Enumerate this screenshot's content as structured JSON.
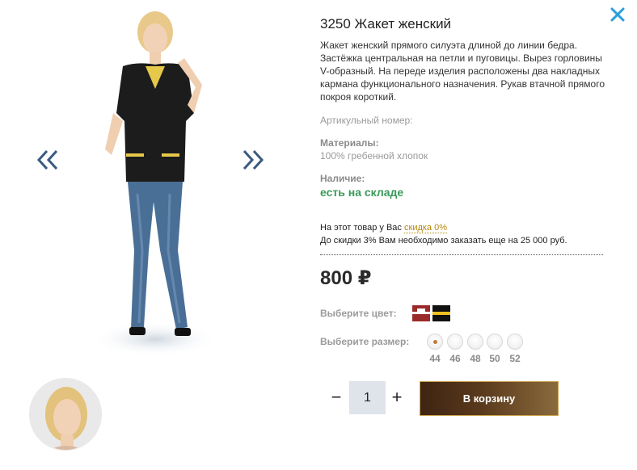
{
  "product": {
    "title": "3250 Жакет женский",
    "description": "Жакет женский прямого силуэта длиной до линии бедра. Застёжка центральная на петли и пуговицы. Вырез горловины V-образный. На переде изделия расположены два накладных кармана функционального назначения. Рукав втачной прямого покроя короткий.",
    "article_label": "Артикульный номер:",
    "materials_label": "Материалы:",
    "materials_value": "100% гребенной хлопок",
    "availability_label": "Наличие:",
    "availability_value": "есть на складе",
    "discount_text": "На этот товар у Вас",
    "discount_link": "скидка 0%",
    "discount_note": "До скидки 3% Вам необходимо заказать еще на 25 000 руб.",
    "price": "800 ₽"
  },
  "options": {
    "color_label": "Выберите цвет:",
    "colors": [
      {
        "name": "red-white",
        "main": "#9a2a2a",
        "accent": "#ffffff"
      },
      {
        "name": "black-yellow",
        "main": "#111111",
        "accent": "#f0c020"
      }
    ],
    "size_label": "Выберите размер:",
    "sizes": [
      "44",
      "46",
      "48",
      "50",
      "52"
    ],
    "selected_size": "44"
  },
  "cart": {
    "quantity": "1",
    "minus_label": "−",
    "plus_label": "+",
    "button_label": "В корзину"
  },
  "colors": {
    "accent_blue": "#2a9fd8",
    "stock_green": "#3a9a5a",
    "discount_gold": "#b8860b"
  }
}
